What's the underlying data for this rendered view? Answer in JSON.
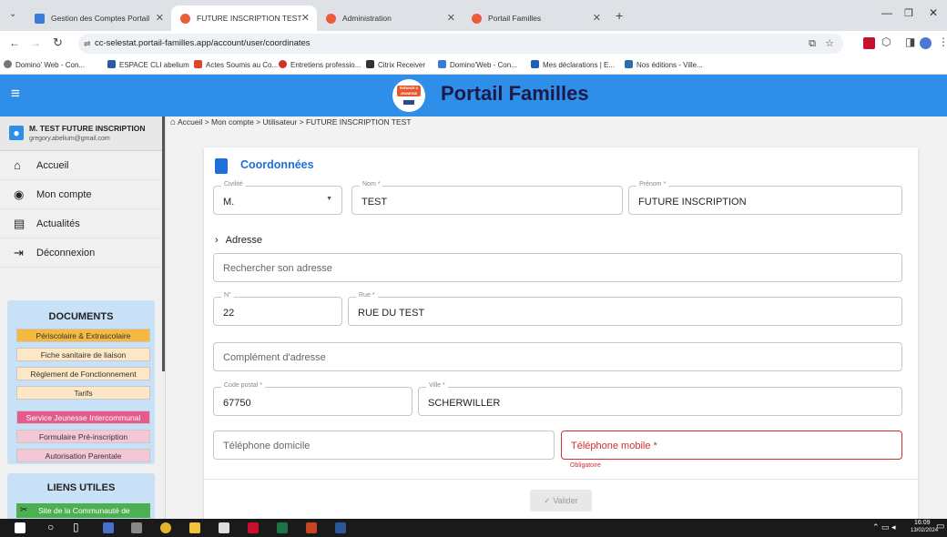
{
  "browser": {
    "tabs": [
      {
        "title": "Gestion des Comptes Portail"
      },
      {
        "title": "FUTURE INSCRIPTION TEST"
      },
      {
        "title": "Administration"
      },
      {
        "title": "Portail Familles"
      }
    ],
    "new_tab": "+",
    "url": "cc-selestat.portail-familles.app/account/user/coordinates",
    "bookmarks": [
      "Domino' Web - Con...",
      "ESPACE CLI abelium",
      "Actes Soumis au Co...",
      "Entretiens professio...",
      "Citrix Receiver",
      "Domino'Web - Con...",
      "Mes déclarations | E...",
      "Nos éditions - Ville..."
    ]
  },
  "header": {
    "title": "Portail Familles",
    "logo_text": "ENFANCE & JEUNESSE"
  },
  "user": {
    "name": "M. TEST FUTURE INSCRIPTION",
    "email": "gregory.abelium@gmail.com"
  },
  "nav": [
    {
      "label": "Accueil"
    },
    {
      "label": "Mon compte"
    },
    {
      "label": "Actualités"
    },
    {
      "label": "Déconnexion"
    }
  ],
  "documents": {
    "title": "DOCUMENTS",
    "items": [
      {
        "label": "Périscolaire & Extrascolaire",
        "color": "#f5b942"
      },
      {
        "label": "Fiche sanitaire de liaison",
        "color": "#fde7c4"
      },
      {
        "label": "Règlement de Fonctionnement",
        "color": "#fde7c4"
      },
      {
        "label": "Tarifs",
        "color": "#fde7c4"
      },
      {
        "label": "Service Jeunesse Intercommunal",
        "color": "#e45b8c"
      },
      {
        "label": "Formulaire Pré-inscription",
        "color": "#f3c7d6"
      },
      {
        "label": "Autorisation Parentale",
        "color": "#f3c7d6"
      }
    ]
  },
  "links": {
    "title": "LIENS UTILES",
    "item": "Site de la Communauté de"
  },
  "breadcrumb": "Accueil > Mon compte > Utilisateur > FUTURE INSCRIPTION TEST",
  "form": {
    "title": "Coordonnées",
    "civilite": {
      "label": "Civilité",
      "value": "M."
    },
    "nom": {
      "label": "Nom *",
      "value": "TEST"
    },
    "prenom": {
      "label": "Prénom *",
      "value": "FUTURE INSCRIPTION"
    },
    "adresse_toggle": "Adresse",
    "search": {
      "placeholder": "Rechercher son adresse"
    },
    "numero": {
      "label": "N°",
      "value": "22"
    },
    "rue": {
      "label": "Rue *",
      "value": "RUE DU TEST"
    },
    "complement": {
      "placeholder": "Complément d'adresse"
    },
    "code_postal": {
      "label": "Code postal *",
      "value": "67750"
    },
    "ville": {
      "label": "Ville *",
      "value": "SCHERWILLER"
    },
    "tel_domicile": {
      "placeholder": "Téléphone domicile"
    },
    "tel_mobile": {
      "placeholder": "Téléphone mobile *",
      "error": "Obligatoire"
    },
    "submit": "Valider"
  },
  "taskbar": {
    "time": "16:09",
    "date": "13/02/2024"
  },
  "colors": {
    "header_blue": "#2f8ee8",
    "accent_blue": "#1e6fd9",
    "error_red": "#d32f2f",
    "doc_panel": "#c9e1f7"
  }
}
